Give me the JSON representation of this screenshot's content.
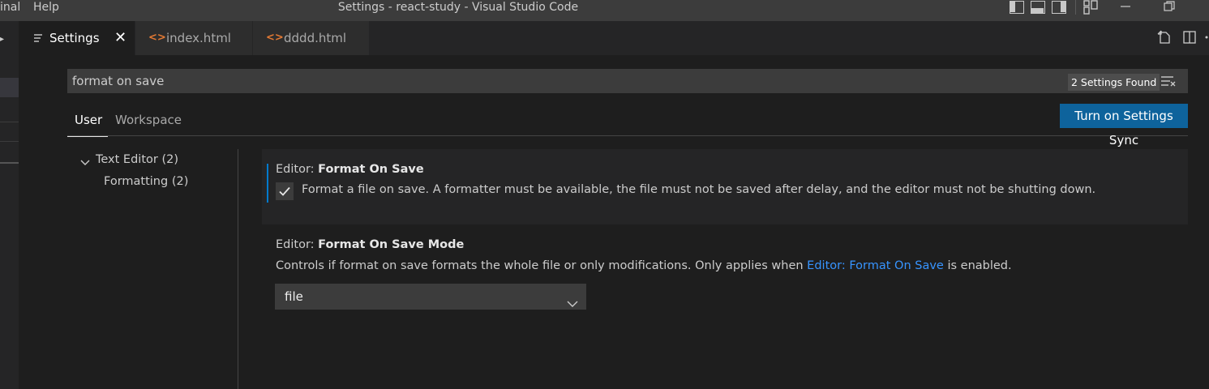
{
  "titlebar": {
    "menu_terminal": "inal",
    "menu_help": "Help",
    "window_title": "Settings - react-study - Visual Studio Code"
  },
  "tabs": [
    {
      "label": "Settings",
      "icon": "list-icon",
      "active": true
    },
    {
      "label": "index.html",
      "icon": "html-code-icon",
      "active": false
    },
    {
      "label": "dddd.html",
      "icon": "html-code-icon",
      "active": false
    }
  ],
  "search": {
    "value": "format on save",
    "results_badge": "2 Settings Found"
  },
  "scopes": {
    "user": "User",
    "workspace": "Workspace"
  },
  "sync_button": "Turn on Settings Sync",
  "toc": {
    "group": "Text Editor (2)",
    "child": "Formatting (2)"
  },
  "settings": [
    {
      "category": "Editor: ",
      "name": "Format On Save",
      "description": "Format a file on save. A formatter must be available, the file must not be saved after delay, and the editor must not be shutting down.",
      "checked": true
    },
    {
      "category": "Editor: ",
      "name": "Format On Save Mode",
      "description_before": "Controls if format on save formats the whole file or only modifications. Only applies when ",
      "description_link": "Editor: Format On Save",
      "description_after": " is enabled.",
      "selected_value": "file"
    }
  ],
  "colors": {
    "accent": "#007acc",
    "button": "#0e639c",
    "link": "#3794ff",
    "html_icon": "#e37933"
  }
}
